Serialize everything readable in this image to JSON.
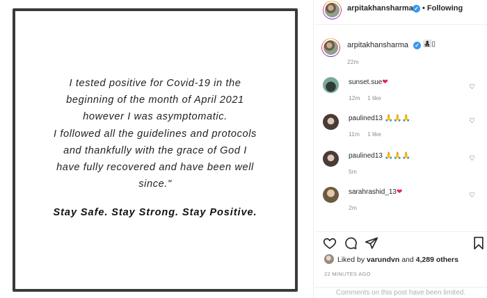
{
  "post": {
    "quote_lines": [
      "I tested positive for Covid-19 in the",
      "beginning of the month of April 2021",
      "however I was asymptomatic.",
      "I followed all the guidelines and protocols",
      "and thankfully with the grace of God I",
      "have fully recovered and have been well",
      "since.\""
    ],
    "motto": "Stay Safe. Stay Strong. Stay Positive."
  },
  "header": {
    "username": "arpitakhansharma",
    "follow_label": "• Following",
    "verified_icon": "check"
  },
  "caption": {
    "username": "arpitakhansharma",
    "emoji": "👩‍👧‍👦▯",
    "time": "22m"
  },
  "comments": [
    {
      "username": "sunset.sue",
      "emoji": "❤",
      "time": "12m",
      "likes": "1 like"
    },
    {
      "username": "paulined13",
      "emoji": "🙏🙏🙏",
      "time": "11m",
      "likes": "1 like"
    },
    {
      "username": "paulined13",
      "emoji": "🙏🙏🙏",
      "time": "5m",
      "likes": ""
    },
    {
      "username": "sarahrashid_13",
      "emoji": "❤",
      "time": "2m",
      "likes": ""
    }
  ],
  "likes": {
    "prefix": "Liked by ",
    "user": "varundvn",
    "middle": " and ",
    "count": "4,289 others"
  },
  "post_time": "22 MINUTES AGO",
  "limited_notice": "Comments on this post have been limited.",
  "colors": {
    "verified": "#3897f0",
    "muted": "#8e8e8e",
    "border": "#efefef",
    "text": "#262626"
  }
}
